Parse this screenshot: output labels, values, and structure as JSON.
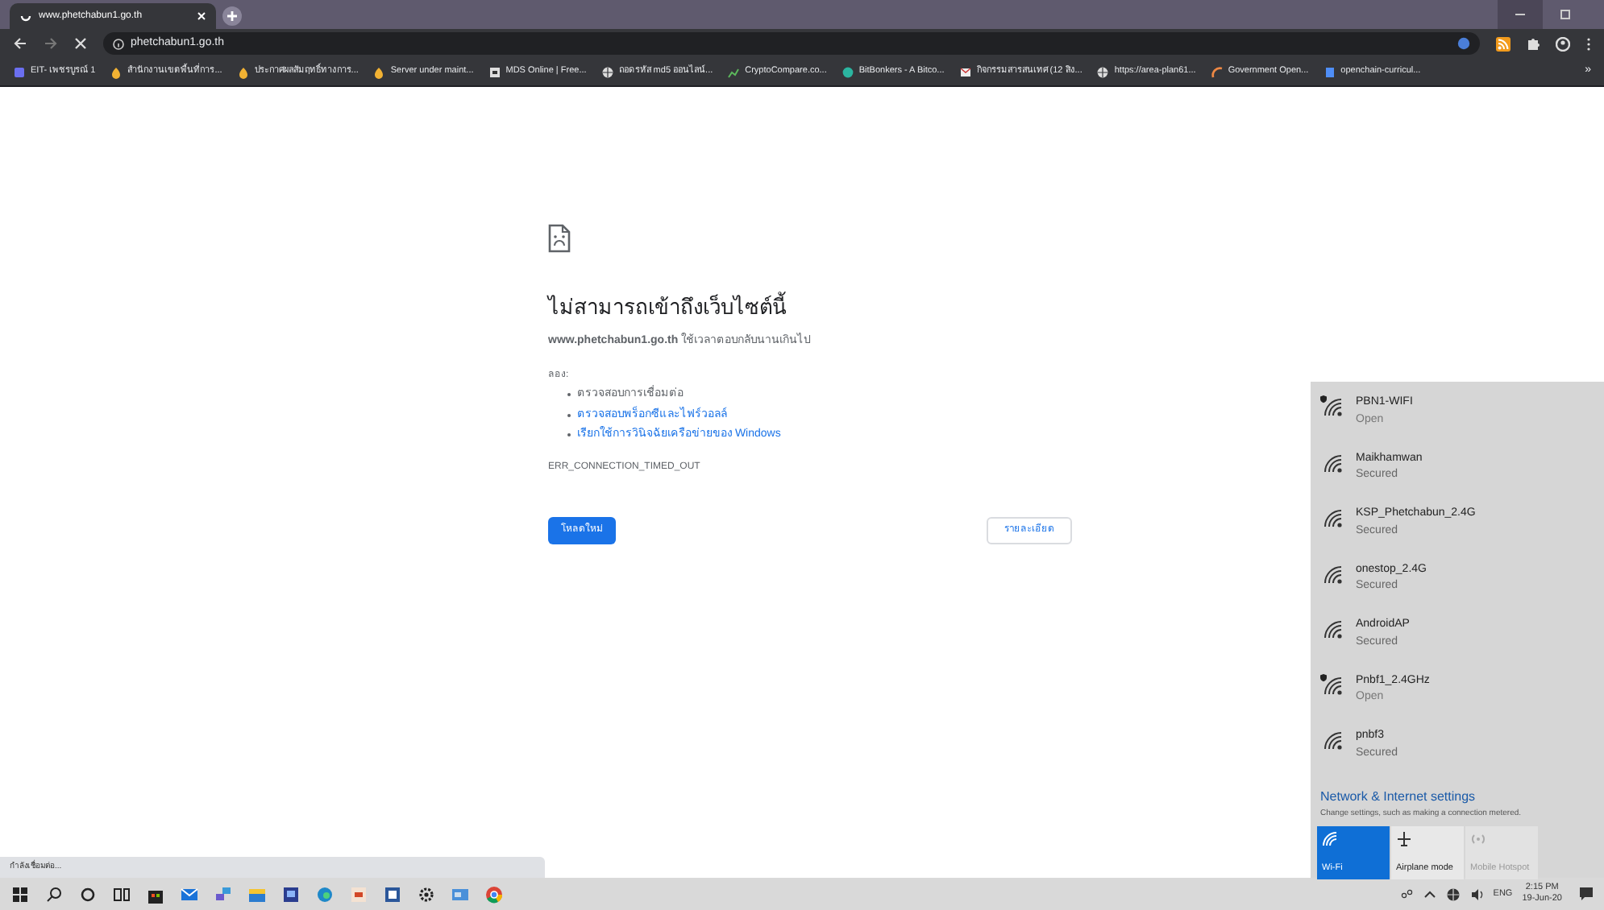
{
  "browser": {
    "tabs": [
      {
        "title": "www.phetchabun1.go.th",
        "loading": true,
        "selected": true
      }
    ],
    "address": "phetchabun1.go.th",
    "bookmarks": [
      {
        "label": "EIT- เพชรบูรณ์ 1",
        "kind": "app"
      },
      {
        "label": "สำนักงานเขตพื้นที่การ...",
        "kind": "drop"
      },
      {
        "label": "ประกาศผลสัมฤทธิ์ทางการ...",
        "kind": "drop"
      },
      {
        "label": "Server under maint...",
        "kind": "drop"
      },
      {
        "label": "MDS Online | Free...",
        "kind": "page"
      },
      {
        "label": "ถอดรหัส md5 ออนไลน์...",
        "kind": "globe"
      },
      {
        "label": "CryptoCompare.co...",
        "kind": "chart"
      },
      {
        "label": "BitBonkers - A Bitco...",
        "kind": "coin"
      },
      {
        "label": "กิจกรรมสารสนเทศ (12 สิง...",
        "kind": "mail"
      },
      {
        "label": "https://area-plan61...",
        "kind": "globe"
      },
      {
        "label": "Government Open...",
        "kind": "arc"
      },
      {
        "label": "openchain-curricul...",
        "kind": "doc"
      }
    ],
    "more": "»"
  },
  "error_page": {
    "heading": "ไม่สามารถเข้าถึงเว็บไซต์นี้",
    "message": "**www.phetchabun1.go.th** ใช้เวลาตอบกลับนานเกินไป",
    "try_label": "ลอง:",
    "suggestions": [
      {
        "text": "ตรวจสอบการเชื่อมต่อ",
        "link": false
      },
      {
        "text": "ตรวจสอบพร็อกซีและไฟร์วอลล์",
        "link": true
      },
      {
        "text": "เรียกใช้การวินิจฉัยเครือข่ายของ Windows",
        "link": true
      }
    ],
    "error_code": "ERR_CONNECTION_TIMED_OUT",
    "reload_button": "โหลดใหม่",
    "details_button": "รายละเอียด"
  },
  "status_bubble": "กำลังเชื่อมต่อ...",
  "wifi_flyout": {
    "networks": [
      {
        "name": "PBN1-WIFI",
        "security": "Open",
        "open": true
      },
      {
        "name": "Maikhamwan",
        "security": "Secured",
        "open": false
      },
      {
        "name": "KSP_Phetchabun_2.4G",
        "security": "Secured",
        "open": false
      },
      {
        "name": "onestop_2.4G",
        "security": "Secured",
        "open": false
      },
      {
        "name": "AndroidAP",
        "security": "Secured",
        "open": false
      },
      {
        "name": "Pnbf1_2.4GHz",
        "security": "Open",
        "open": true
      },
      {
        "name": "pnbf3",
        "security": "Secured",
        "open": false
      }
    ],
    "settings_link": "Network & Internet settings",
    "settings_hint": "Change settings, such as making a connection metered.",
    "quick_actions": [
      {
        "label": "Wi-Fi",
        "kind": "wifi",
        "on": true,
        "disabled": false
      },
      {
        "label": "Airplane mode",
        "kind": "airplane",
        "on": false,
        "disabled": false
      },
      {
        "label": "Mobile Hotspot",
        "kind": "hotspot",
        "on": false,
        "disabled": true
      }
    ]
  },
  "taskbar": {
    "language": "ENG",
    "time": "2:15 PM",
    "date": "19-Jun-20"
  }
}
